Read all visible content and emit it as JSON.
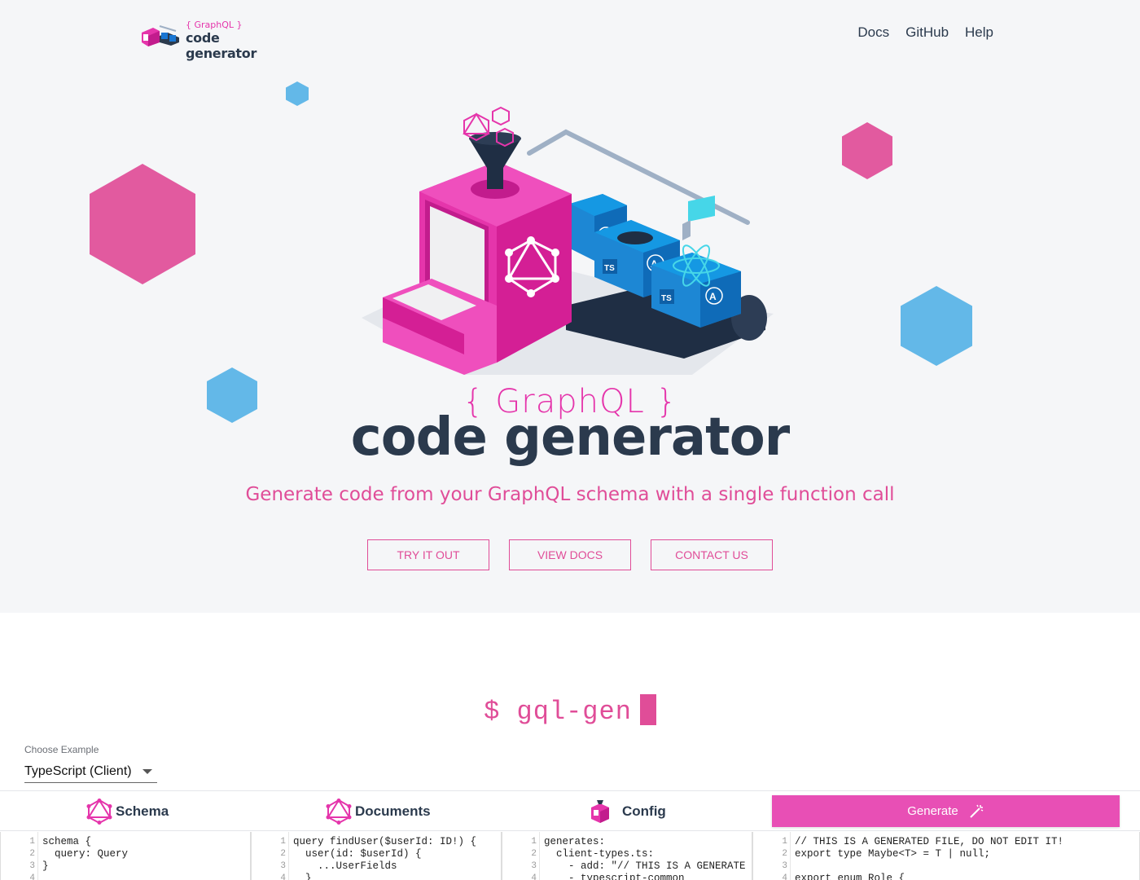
{
  "nav": {
    "logo_line1": "{ GraphQL }",
    "logo_line2": "code generator",
    "links": [
      "Docs",
      "GitHub",
      "Help"
    ]
  },
  "hero": {
    "title_small": "{ GraphQL }",
    "title_big": "code generator",
    "tagline": "Generate code from your GraphQL schema with a single function call",
    "buttons": [
      "TRY IT OUT",
      "VIEW DOCS",
      "CONTACT US"
    ],
    "illustration_labels": {
      "ts": "TS",
      "a": "A"
    }
  },
  "terminal": {
    "prompt": "$ gql-gen"
  },
  "example_select": {
    "label": "Choose Example",
    "value": "TypeScript (Client)"
  },
  "panels": {
    "schema": "Schema",
    "documents": "Documents",
    "config": "Config",
    "generate": "Generate"
  },
  "editors": {
    "schema": [
      "schema {",
      "  query: Query",
      "}",
      ""
    ],
    "documents": [
      "query findUser($userId: ID!) {",
      "  user(id: $userId) {",
      "    ...UserFields",
      "  }"
    ],
    "config": [
      "generates:",
      "  client-types.ts:",
      "    - add: \"// THIS IS A GENERATE",
      "    - typescript-common"
    ],
    "output": [
      "// THIS IS A GENERATED FILE, DO NOT EDIT IT!",
      "export type Maybe<T> = T | null;",
      "",
      "export enum Role {"
    ]
  },
  "colors": {
    "pink": "#e535ab",
    "navy": "#2b3a4d",
    "blue": "#63b8e8",
    "button_pink": "#e84fb5"
  }
}
